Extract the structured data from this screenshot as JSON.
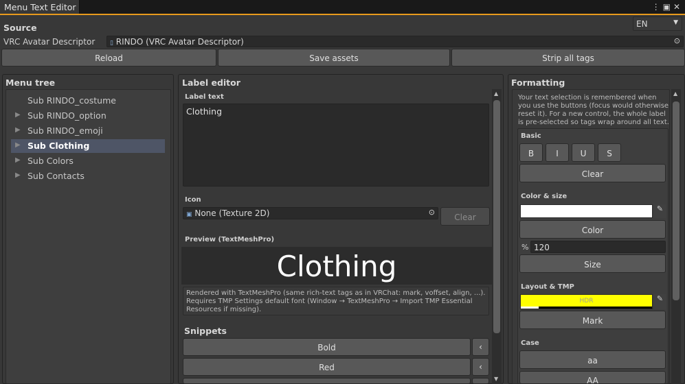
{
  "window": {
    "tab_title": "Menu Text Editor"
  },
  "source": {
    "header": "Source",
    "lang": "EN",
    "descriptor_label": "VRC Avatar Descriptor",
    "descriptor_value": "RINDO (VRC Avatar Descriptor)",
    "reload": "Reload",
    "save": "Save assets",
    "strip": "Strip all tags"
  },
  "menu_tree": {
    "header": "Menu tree",
    "items": [
      {
        "prefix": "Sub",
        "name": "RINDO_costume"
      },
      {
        "prefix": "Sub",
        "name": "RINDO_option"
      },
      {
        "prefix": "Sub",
        "name": "RINDO_emoji"
      },
      {
        "prefix": "Sub",
        "name": "Clothing"
      },
      {
        "prefix": "Sub",
        "name": "Colors"
      },
      {
        "prefix": "Sub",
        "name": "Contacts"
      }
    ]
  },
  "label_editor": {
    "header": "Label editor",
    "label_text_title": "Label text",
    "label_text_value": "Clothing",
    "icon_title": "Icon",
    "icon_value": "None (Texture 2D)",
    "icon_clear": "Clear",
    "preview_title": "Preview (TextMeshPro)",
    "preview_text": "Clothing",
    "note": "Rendered with TextMeshPro (same rich-text tags as in VRChat: mark, voffset, align, ...). Requires TMP Settings default font (Window → TextMeshPro → Import TMP Essential Resources if missing).",
    "snippets_title": "Snippets",
    "snippets": [
      {
        "label": "Bold"
      },
      {
        "label": "Red"
      }
    ]
  },
  "formatting": {
    "header": "Formatting",
    "note": "Your text selection is remembered when you use the buttons (focus would otherwise reset it). For a new control, the whole label is pre-selected so tags wrap around all text.",
    "basic_title": "Basic",
    "basic_buttons": [
      "B",
      "I",
      "U",
      "S"
    ],
    "clear": "Clear",
    "color_size_title": "Color & size",
    "color_swatch": "#ffffff",
    "color_button": "Color",
    "percent_symbol": "%",
    "size_value": "120",
    "size_button": "Size",
    "layout_title": "Layout & TMP",
    "hdr_label": "HDR",
    "mark_color": "#ffff00",
    "mark_button": "Mark",
    "case_title": "Case",
    "case_buttons": [
      "aa",
      "AA"
    ]
  },
  "colors": {
    "accent": "#e89a1c",
    "selection": "#4e5566"
  }
}
